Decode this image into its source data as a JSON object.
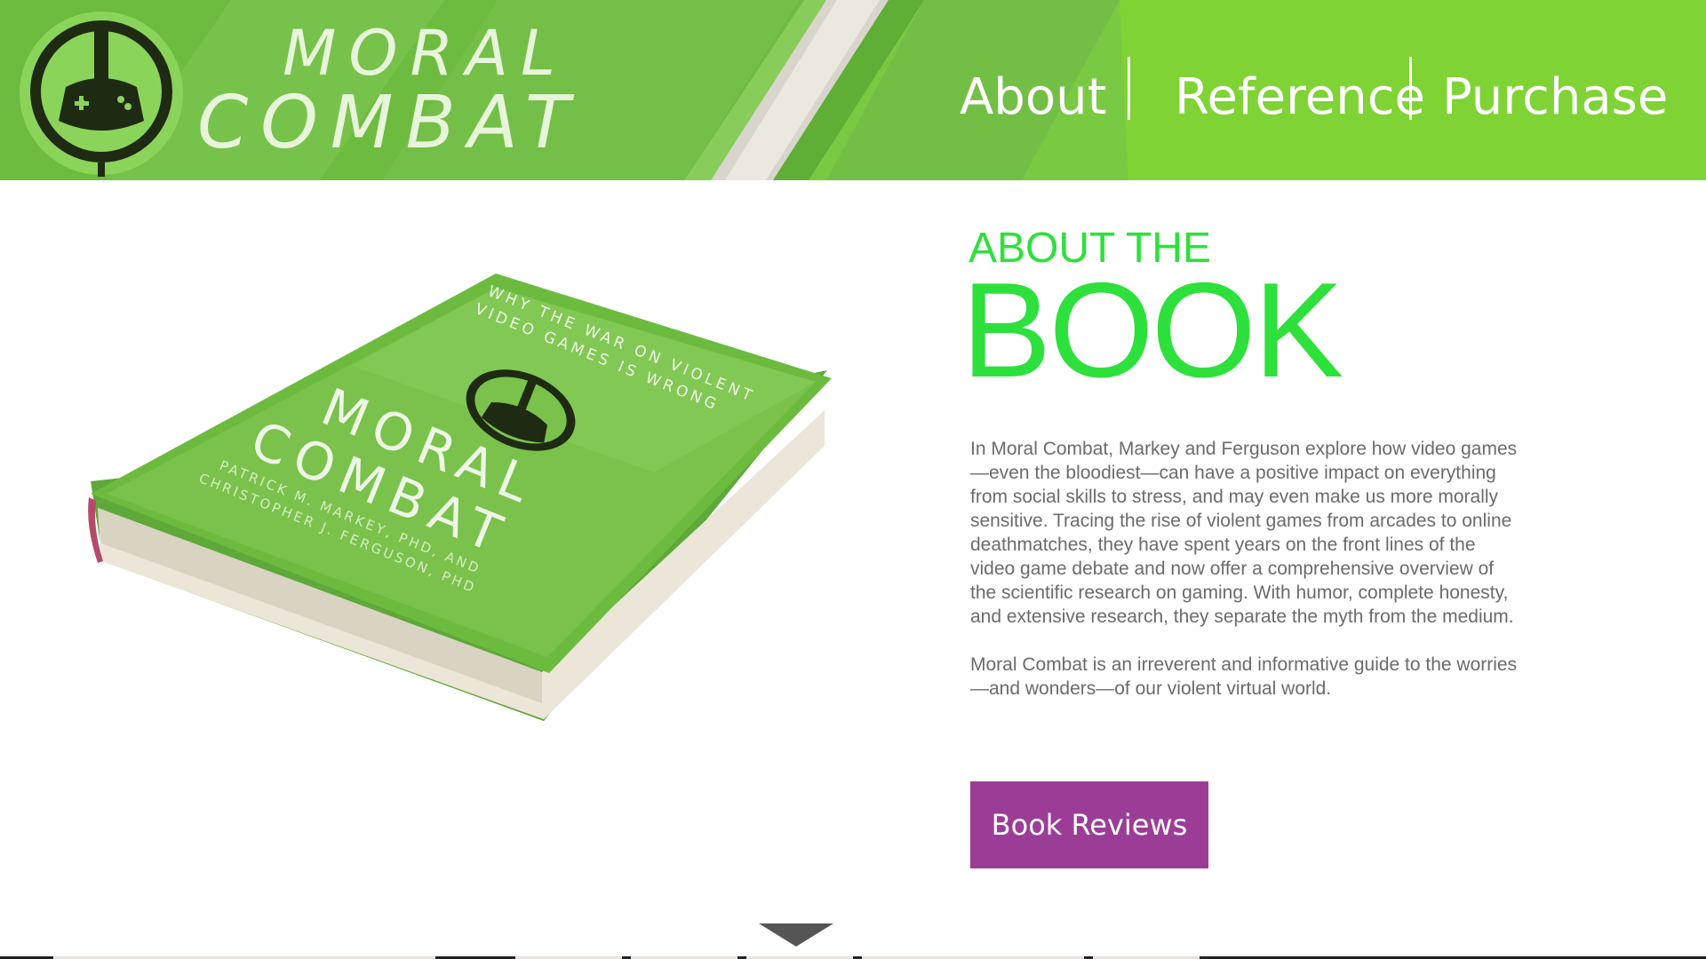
{
  "brand": {
    "wordmark_line1": "MORAL",
    "wordmark_line2": "COMBAT",
    "logo_icon": "peace-controller-icon",
    "colors": {
      "header_green": "#7ac943",
      "heading_green": "#2ee03c",
      "button_purple": "#9b3d96"
    }
  },
  "nav": {
    "items": [
      {
        "label": "About"
      },
      {
        "label": "Reference"
      },
      {
        "label": "Purchase"
      }
    ]
  },
  "main": {
    "heading_small": "ABOUT THE",
    "heading_big": "BOOK",
    "paragraphs": [
      "In Moral Combat, Markey and Ferguson explore how video games—even the bloodiest—can have a positive impact on everything from social skills to stress, and may even make us more morally sensitive. Tracing the rise of violent games from arcades to online deathmatches, they have spent years on the front lines of the video game debate and now offer a comprehensive overview of the scientific research on gaming. With humor, complete honesty, and extensive research, they separate the myth from the medium.",
      "Moral Combat is an irreverent and informative guide to the worries—and wonders—of our violent virtual world."
    ],
    "button_label": "Book Reviews",
    "scroll_icon": "chevron-down-icon"
  },
  "book_cover": {
    "tagline_line1": "WHY THE WAR ON VIOLENT",
    "tagline_line2": "VIDEO GAMES IS WRONG",
    "title_line1": "MORAL",
    "title_line2": "COMBAT",
    "author_line1": "PATRICK M. MARKEY, PHD, AND",
    "author_line2": "CHRISTOPHER J. FERGUSON, PHD"
  }
}
